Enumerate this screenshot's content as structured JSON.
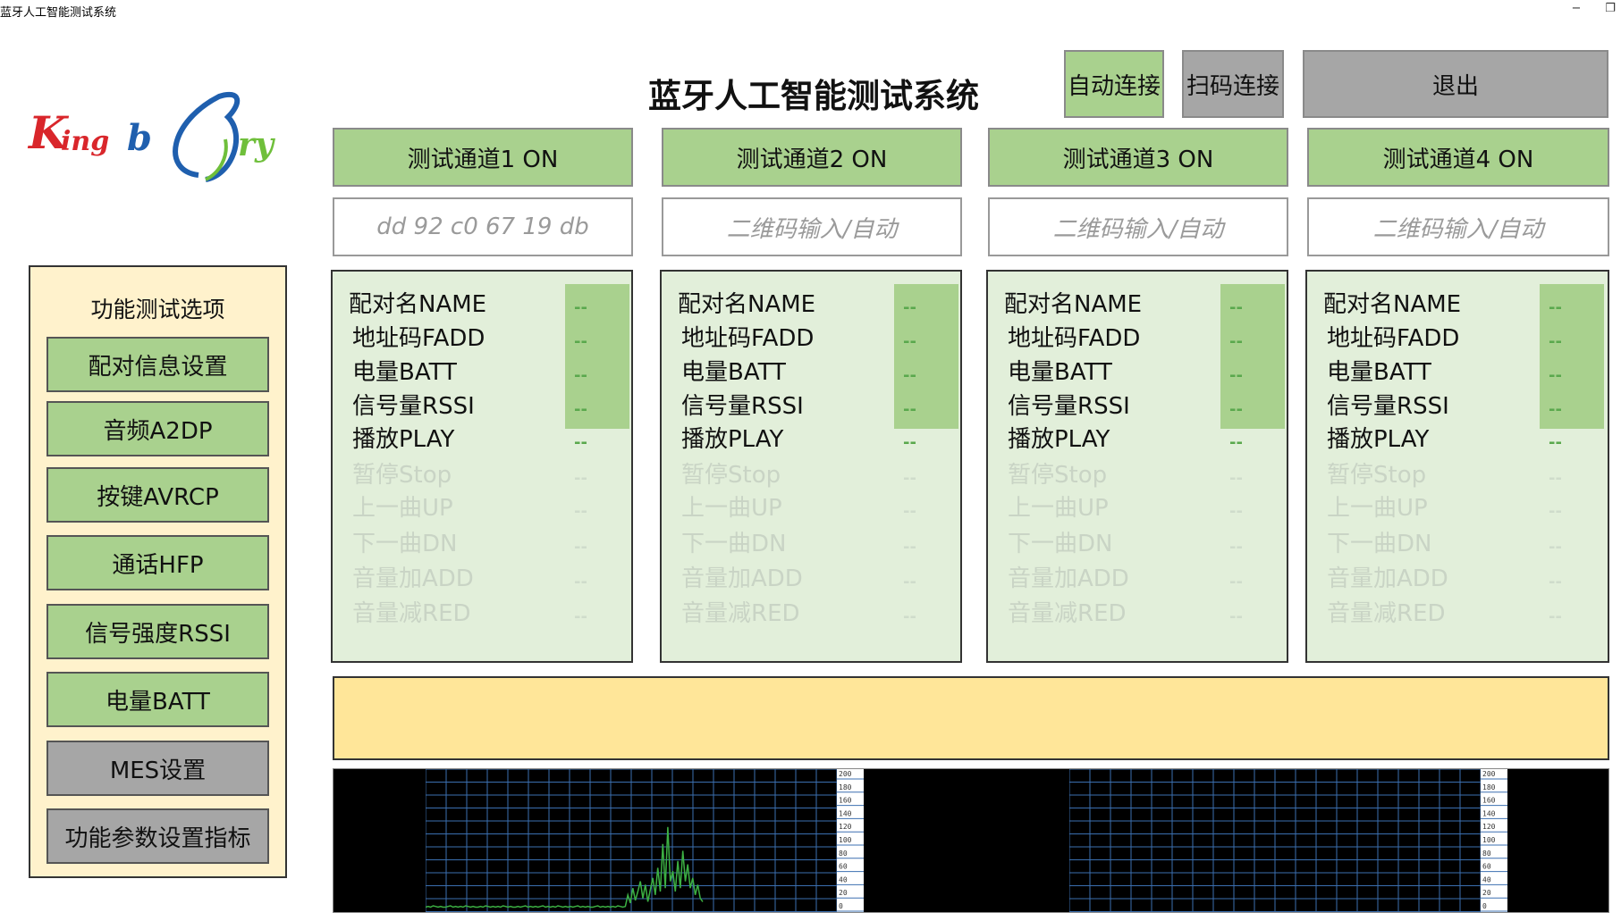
{
  "window": {
    "title": "蓝牙人工智能测试系统",
    "minimize_glyph": "−",
    "restore_glyph": "❐"
  },
  "logo": {
    "text_left": "Kingb",
    "text_right": "ry",
    "colors": {
      "red": "#d9262b",
      "blue": "#1f5fae",
      "green": "#6fbf3b"
    }
  },
  "header": {
    "title": "蓝牙人工智能测试系统",
    "auto_connect_label": "自动连接",
    "scan_connect_label": "扫码连接",
    "exit_label": "退出"
  },
  "left_panel": {
    "title": "功能测试选项",
    "items": [
      {
        "label": "配对信息设置",
        "style": "green"
      },
      {
        "label": "音频A2DP",
        "style": "green"
      },
      {
        "label": "按键AVRCP",
        "style": "green"
      },
      {
        "label": "通话HFP",
        "style": "green"
      },
      {
        "label": "信号强度RSSI",
        "style": "green"
      },
      {
        "label": "电量BATT",
        "style": "green"
      },
      {
        "label": "MES设置",
        "style": "gray"
      },
      {
        "label": "功能参数设置指标",
        "style": "gray"
      }
    ]
  },
  "channels": [
    {
      "button_label": "测试通道1 ON",
      "input_text": "dd 92 c0 67 19 db"
    },
    {
      "button_label": "测试通道2 ON",
      "input_text": "二维码输入/自动"
    },
    {
      "button_label": "测试通道3 ON",
      "input_text": "二维码输入/自动"
    },
    {
      "button_label": "测试通道4 ON",
      "input_text": "二维码输入/自动"
    }
  ],
  "channel_panel": {
    "header": "配对名NAME",
    "rows": [
      {
        "label": "地址码FADD",
        "value": "--",
        "active": true
      },
      {
        "label": "电量BATT",
        "value": "--",
        "active": true
      },
      {
        "label": "信号量RSSI",
        "value": "--",
        "active": true
      },
      {
        "label": "播放PLAY",
        "value": "--",
        "active": true
      },
      {
        "label": "暂停Stop",
        "value": "--",
        "active": false
      },
      {
        "label": "上一曲UP",
        "value": "--",
        "active": false
      },
      {
        "label": "下一曲DN",
        "value": "--",
        "active": false
      },
      {
        "label": "音量加ADD",
        "value": "--",
        "active": false
      },
      {
        "label": "音量减RED",
        "value": "--",
        "active": false
      }
    ],
    "header_value": "--"
  },
  "message_bar": {
    "text": ""
  },
  "charts": [
    {
      "scale_labels": [
        "200",
        "180",
        "160",
        "140",
        "120",
        "100",
        "80",
        "60",
        "40",
        "20",
        "0"
      ],
      "chart_data": {
        "type": "line",
        "ylim": [
          0,
          200
        ],
        "grid": true,
        "series_color": "#3cb043",
        "values": [
          2,
          3,
          2,
          4,
          3,
          2,
          3,
          2,
          2,
          3,
          4,
          2,
          3,
          2,
          3,
          2,
          4,
          3,
          2,
          3,
          2,
          2,
          3,
          2,
          4,
          3,
          2,
          3,
          2,
          3,
          2,
          4,
          3,
          2,
          3,
          2,
          2,
          3,
          2,
          3,
          4,
          2,
          3,
          2,
          3,
          2,
          3,
          4,
          2,
          3,
          2,
          3,
          2,
          4,
          3,
          2,
          3,
          2,
          3,
          2,
          3,
          4,
          2,
          3,
          2,
          3,
          2,
          2,
          3,
          4,
          2,
          3,
          2,
          3,
          2,
          3,
          2,
          4,
          3,
          2,
          3,
          20,
          8,
          30,
          12,
          25,
          40,
          15,
          35,
          10,
          28,
          45,
          20,
          60,
          25,
          95,
          30,
          120,
          40,
          55,
          25,
          70,
          30,
          85,
          40,
          65,
          30,
          45,
          20,
          35,
          15,
          10
        ]
      }
    },
    {
      "scale_labels": [
        "200",
        "180",
        "160",
        "140",
        "120",
        "100",
        "80",
        "60",
        "40",
        "20",
        "0"
      ],
      "chart_data": {
        "type": "line",
        "ylim": [
          0,
          200
        ],
        "grid": true,
        "series_color": "#3cb043",
        "values": []
      }
    }
  ]
}
